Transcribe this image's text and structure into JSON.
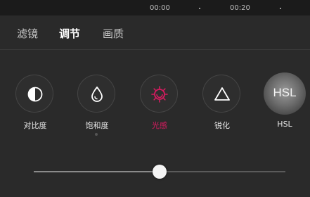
{
  "timeline": {
    "ticks": [
      "00:00",
      "00:20"
    ]
  },
  "tabs": [
    {
      "label": "滤镜",
      "active": false
    },
    {
      "label": "调节",
      "active": true
    },
    {
      "label": "画质",
      "active": false
    }
  ],
  "tools": [
    {
      "label": "对比度",
      "icon": "contrast-icon"
    },
    {
      "label": "饱和度",
      "icon": "droplet-icon"
    },
    {
      "label": "光感",
      "icon": "light-sense-icon",
      "active": true
    },
    {
      "label": "锐化",
      "icon": "triangle-icon"
    },
    {
      "label": "HSL",
      "icon": "hsl-icon",
      "badge": "HSL"
    }
  ],
  "slider": {
    "value": 0.5
  },
  "colors": {
    "accent": "#d81b60",
    "background": "#2a2a2a",
    "text": "#e6e6e6"
  }
}
